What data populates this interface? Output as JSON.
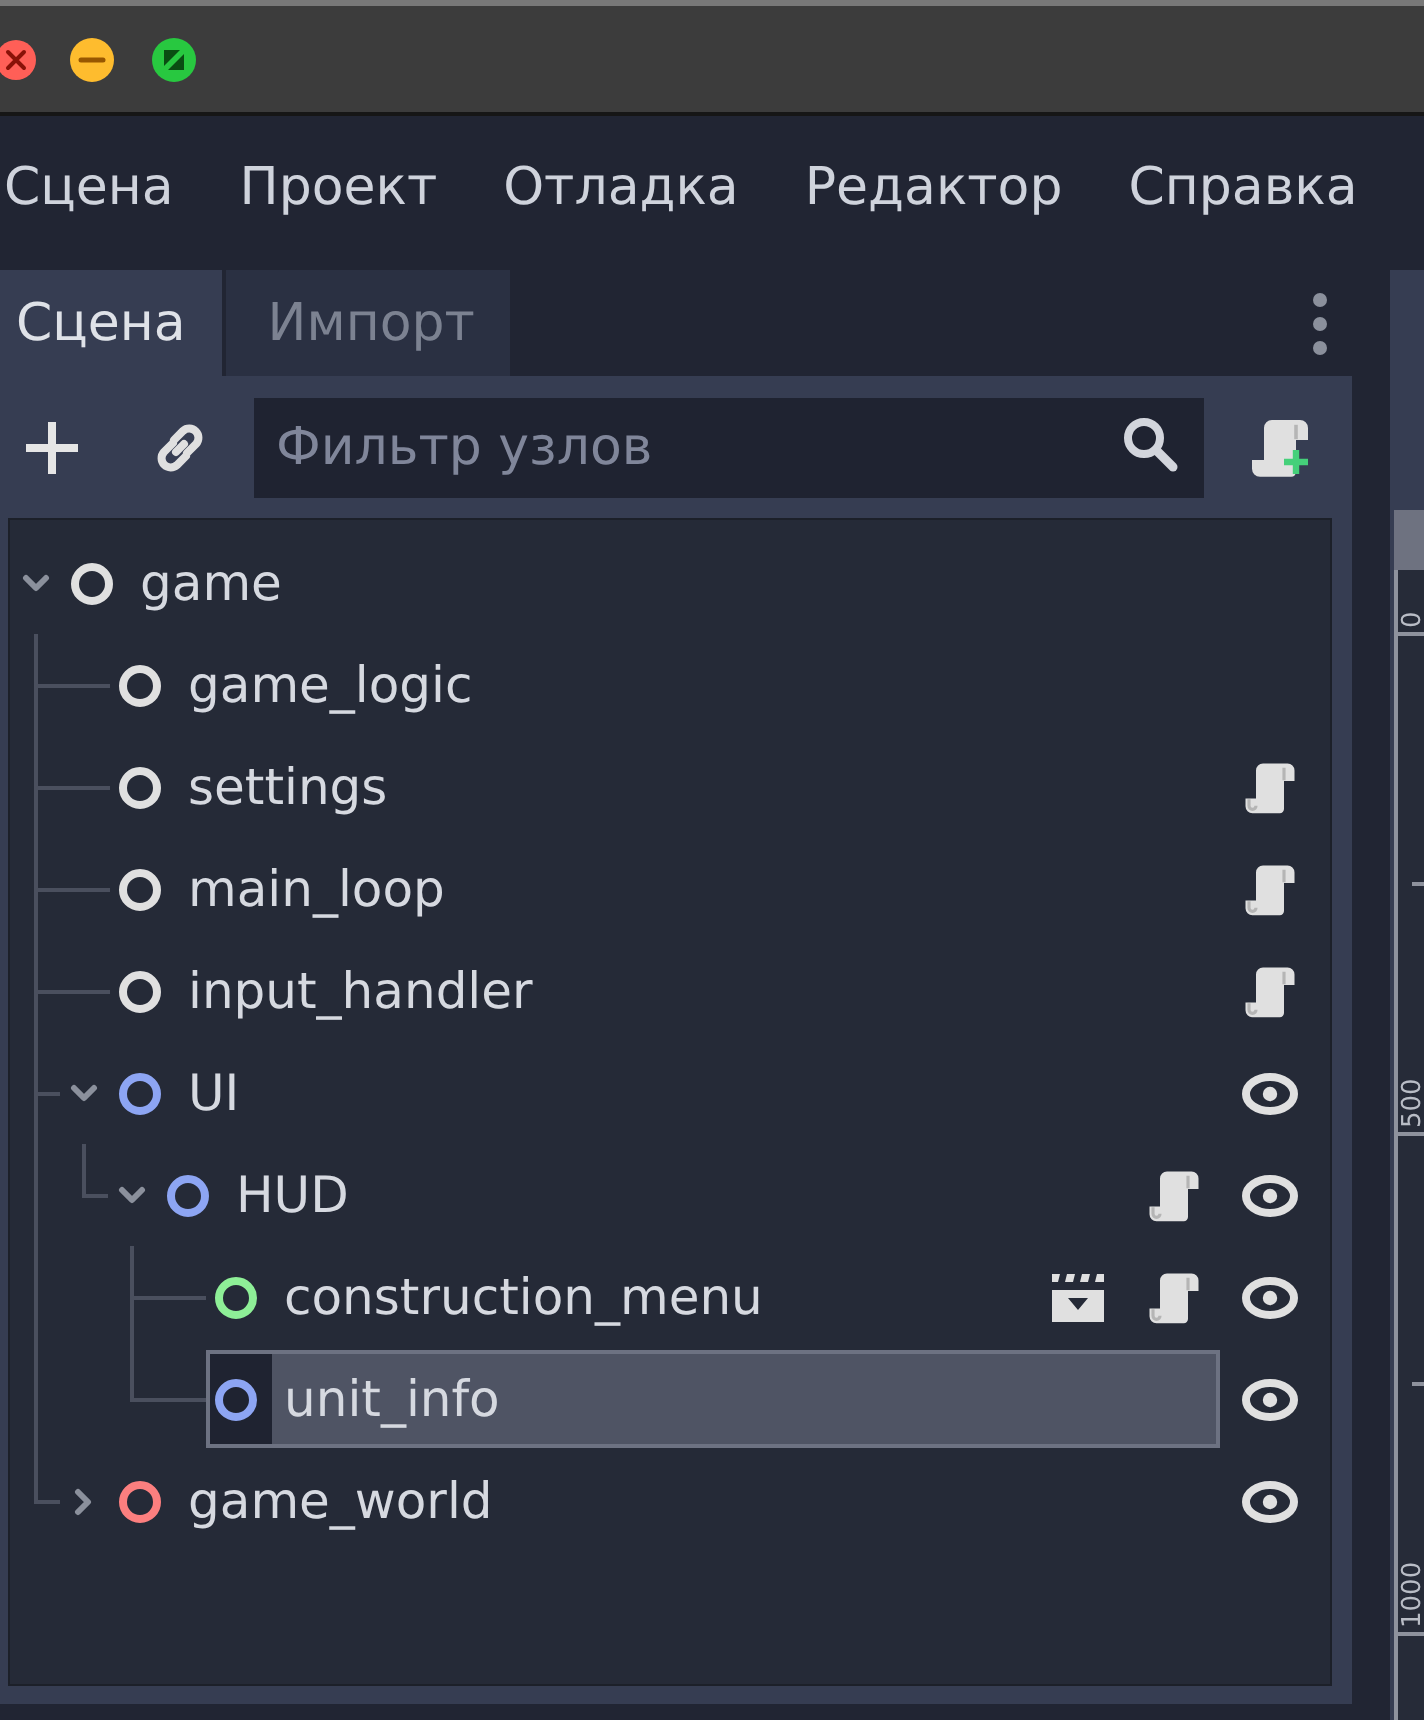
{
  "menu_bar": [
    "Сцена",
    "Проект",
    "Отладка",
    "Редактор",
    "Справка"
  ],
  "dock_tabs": [
    {
      "label": "Сцена",
      "selected": true
    },
    {
      "label": "Импорт",
      "selected": false
    }
  ],
  "filter": {
    "placeholder": "Фильтр узлов"
  },
  "scene_tree": [
    {
      "name": "game",
      "color": "#e0e0e0",
      "expanded": true,
      "script": false,
      "instanced": false,
      "selected": false,
      "children": [
        {
          "name": "game_logic",
          "color": "#e0e0e0",
          "script": false,
          "instanced": false,
          "selected": false
        },
        {
          "name": "settings",
          "color": "#e0e0e0",
          "script": true,
          "instanced": false,
          "selected": false
        },
        {
          "name": "main_loop",
          "color": "#e0e0e0",
          "script": true,
          "instanced": false,
          "selected": false
        },
        {
          "name": "input_handler",
          "color": "#e0e0e0",
          "script": true,
          "instanced": false,
          "selected": false
        },
        {
          "name": "UI",
          "color": "#8da5f3",
          "expanded": true,
          "script": false,
          "instanced": false,
          "visible": true,
          "selected": false,
          "children": [
            {
              "name": "HUD",
              "color": "#8da5f3",
              "expanded": true,
              "script": true,
              "instanced": false,
              "visible": true,
              "selected": false,
              "children": [
                {
                  "name": "construction_menu",
                  "color": "#8eef97",
                  "script": true,
                  "instanced": true,
                  "visible": true,
                  "selected": false
                },
                {
                  "name": "unit_info",
                  "color": "#8da5f3",
                  "script": false,
                  "instanced": false,
                  "visible": true,
                  "selected": true
                }
              ]
            }
          ]
        },
        {
          "name": "game_world",
          "color": "#fc7f7f",
          "expanded": false,
          "script": false,
          "instanced": false,
          "visible": true,
          "selected": false
        }
      ]
    }
  ],
  "ruler": {
    "labels": [
      "0",
      "500",
      "1000"
    ]
  }
}
